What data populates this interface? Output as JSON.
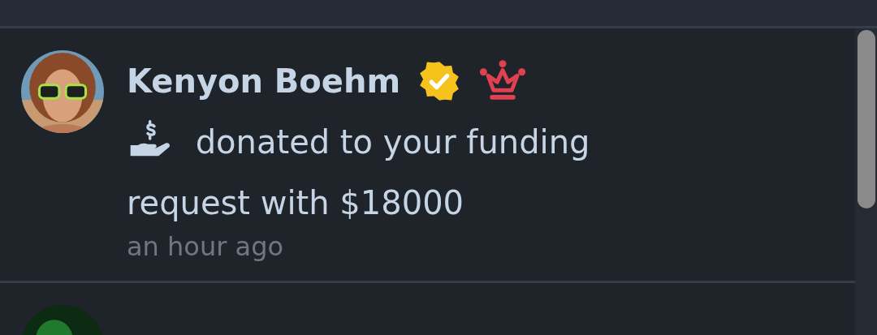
{
  "notifications": [
    {
      "avatar": {
        "kind": "picture"
      },
      "name": "Kenyon Boehm",
      "verified": true,
      "crown": true,
      "message_lines": [
        "donated to your funding",
        "request with $18000"
      ],
      "time": "an hour ago"
    },
    {
      "avatar": {
        "kind": "picture"
      }
    }
  ]
}
